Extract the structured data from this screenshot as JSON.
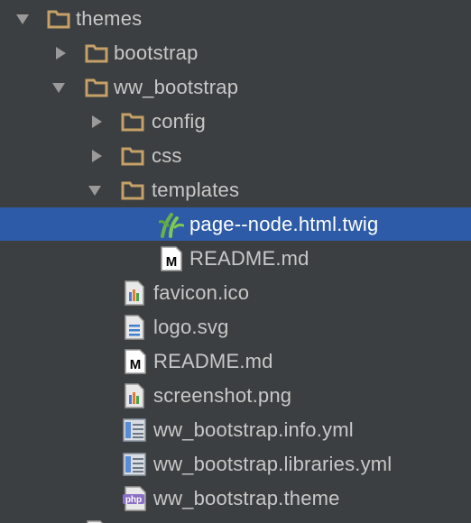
{
  "tree": {
    "items": [
      {
        "label": "themes",
        "type": "folder",
        "expanded": true,
        "depth": 0
      },
      {
        "label": "bootstrap",
        "type": "folder",
        "expanded": false,
        "depth": 1
      },
      {
        "label": "ww_bootstrap",
        "type": "folder",
        "expanded": true,
        "depth": 1
      },
      {
        "label": "config",
        "type": "folder",
        "expanded": false,
        "depth": 2
      },
      {
        "label": "css",
        "type": "folder",
        "expanded": false,
        "depth": 2
      },
      {
        "label": "templates",
        "type": "folder",
        "expanded": true,
        "depth": 2
      },
      {
        "label": "page--node.html.twig",
        "type": "twig-file",
        "selected": true,
        "depth": 3
      },
      {
        "label": "README.md",
        "type": "markdown-file",
        "depth": 3
      },
      {
        "label": "favicon.ico",
        "type": "image-file",
        "depth": 2
      },
      {
        "label": "logo.svg",
        "type": "text-file",
        "depth": 2
      },
      {
        "label": "README.md",
        "type": "markdown-file",
        "depth": 2
      },
      {
        "label": "screenshot.png",
        "type": "image-file",
        "depth": 2
      },
      {
        "label": "ww_bootstrap.info.yml",
        "type": "yml-file",
        "depth": 2
      },
      {
        "label": "ww_bootstrap.libraries.yml",
        "type": "yml-file",
        "depth": 2
      },
      {
        "label": "ww_bootstrap.theme",
        "type": "php-file",
        "depth": 2
      }
    ]
  },
  "colors": {
    "background": "#3c3f41",
    "selection": "#2d5ba7",
    "text": "#c8c8c8",
    "selected_text": "#ffffff",
    "folder": "#c5a168",
    "arrow": "#9a9a9a"
  }
}
